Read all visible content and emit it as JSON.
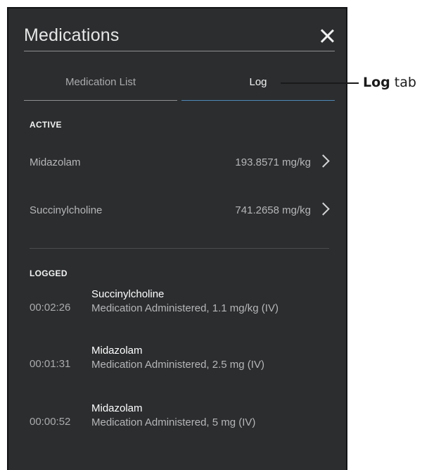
{
  "dialog": {
    "title": "Medications",
    "close_icon": "close-icon"
  },
  "tabs": [
    {
      "label": "Medication List",
      "active": false
    },
    {
      "label": "Log",
      "active": true
    }
  ],
  "active_section": {
    "title": "ACTIVE",
    "items": [
      {
        "name": "Midazolam",
        "dose": "193.8571 mg/kg"
      },
      {
        "name": "Succinylcholine",
        "dose": "741.2658 mg/kg"
      }
    ]
  },
  "logged_section": {
    "title": "LOGGED",
    "entries": [
      {
        "time": "00:02:26",
        "medication": "Succinylcholine",
        "detail": "Medication Administered, 1.1 mg/kg (IV)"
      },
      {
        "time": "00:01:31",
        "medication": "Midazolam",
        "detail": "Medication Administered, 2.5 mg (IV)"
      },
      {
        "time": "00:00:52",
        "medication": "Midazolam",
        "detail": "Medication Administered, 5 mg (IV)"
      }
    ]
  },
  "annotation": {
    "bold": "Log",
    "rest": " tab"
  },
  "colors": {
    "panel": "#2b2d2f",
    "active_tab_underline": "#4f88b5"
  }
}
